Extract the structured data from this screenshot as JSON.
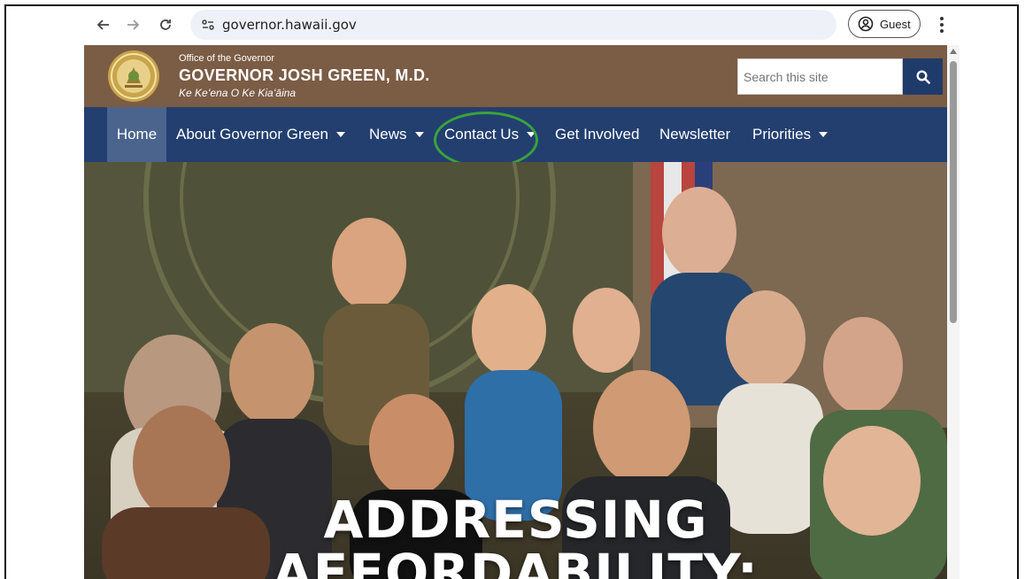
{
  "browser": {
    "url": "governor.hawaii.gov",
    "profile_label": "Guest"
  },
  "header": {
    "office": "Office of the Governor",
    "name": "GOVERNOR JOSH GREEN, M.D.",
    "tagline": "Ke Keʻena O Ke Kiaʻāina",
    "search_placeholder": "Search this site",
    "colors": {
      "header_bg": "#7b5c45",
      "nav_bg": "#233f70",
      "search_button": "#1f3b6a"
    }
  },
  "nav": {
    "items": [
      {
        "label": "Home"
      },
      {
        "label": "About Governor Green"
      },
      {
        "label": "News"
      },
      {
        "label": "Contact Us"
      },
      {
        "label": "Get Involved"
      },
      {
        "label": "Newsletter"
      },
      {
        "label": "Priorities"
      }
    ],
    "highlight_color": "#3aa33a"
  },
  "hero": {
    "headline_line1": "ADDRESSING",
    "headline_line2": "AFFORDABILITY:"
  }
}
